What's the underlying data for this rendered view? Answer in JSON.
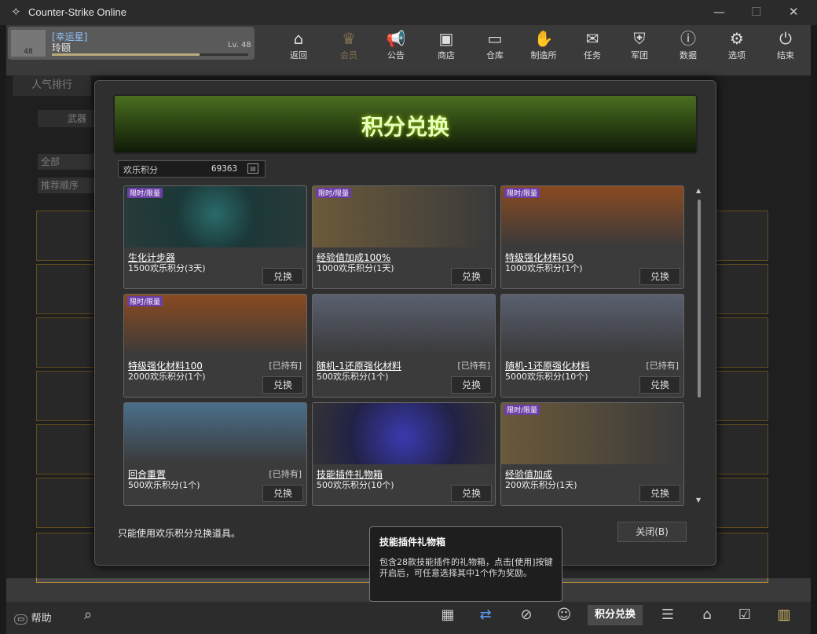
{
  "window": {
    "title": "Counter-Strike Online"
  },
  "profile": {
    "title": "[幸运星]",
    "name": "玲颐",
    "level": "Lv. 48",
    "badge": "48",
    "progress": 0.75
  },
  "nav": [
    {
      "label": "返回",
      "icon": "home-icon"
    },
    {
      "label": "会员",
      "icon": "crown-icon"
    },
    {
      "label": "公告",
      "icon": "megaphone-icon"
    },
    {
      "label": "商店",
      "icon": "shop-icon"
    },
    {
      "label": "仓库",
      "icon": "inventory-icon"
    },
    {
      "label": "制造所",
      "icon": "craft-icon"
    },
    {
      "label": "任务",
      "icon": "mission-icon"
    },
    {
      "label": "军团",
      "icon": "clan-icon"
    },
    {
      "label": "数据",
      "icon": "data-icon"
    },
    {
      "label": "选项",
      "icon": "gear-icon"
    },
    {
      "label": "结束",
      "icon": "power-icon"
    }
  ],
  "background": {
    "tab": "人气排行",
    "filter": "全部",
    "sort": "推荐顺序",
    "weapon": "武器"
  },
  "dialog": {
    "title": "积分兑换",
    "points_label": "欢乐积分",
    "points_value": "69363",
    "note": "只能使用欢乐积分兑换道具。",
    "close_label": "关闭(B)"
  },
  "items": [
    {
      "tag": "限时/限量",
      "name": "生化计步器",
      "owned": "",
      "cost": "1500欢乐积分(3天)",
      "btn": "兑换"
    },
    {
      "tag": "限时/限量",
      "name": "经验值加成100%",
      "owned": "",
      "cost": "1000欢乐积分(1天)",
      "btn": "兑换"
    },
    {
      "tag": "限时/限量",
      "name": "特级强化材料50",
      "owned": "",
      "cost": "1000欢乐积分(1个)",
      "btn": "兑换"
    },
    {
      "tag": "限时/限量",
      "name": "特级强化材料100",
      "owned": "[已持有]",
      "cost": "2000欢乐积分(1个)",
      "btn": "兑换"
    },
    {
      "tag": "",
      "name": "随机-1还原强化材料",
      "owned": "[已持有]",
      "cost": "500欢乐积分(1个)",
      "btn": "兑换"
    },
    {
      "tag": "",
      "name": "随机-1还原强化材料",
      "owned": "[已持有]",
      "cost": "5000欢乐积分(10个)",
      "btn": "兑换"
    },
    {
      "tag": "",
      "name": "回合重置",
      "owned": "[已持有]",
      "cost": "500欢乐积分(1个)",
      "btn": "兑换"
    },
    {
      "tag": "",
      "name": "技能插件礼物箱",
      "owned": "",
      "cost": "500欢乐积分(10个)",
      "btn": "兑换"
    },
    {
      "tag": "限时/限量",
      "name": "经验值加成",
      "owned": "",
      "cost": "200欢乐积分(1天)",
      "btn": "兑换"
    }
  ],
  "tooltip": {
    "title": "技能插件礼物箱",
    "desc": "包含28款技能插件的礼物箱，点击[使用]按键开启后，可任意选择其中1个作为奖励。"
  },
  "bottombar": {
    "active_label": "积分兑换",
    "help": "帮助"
  }
}
